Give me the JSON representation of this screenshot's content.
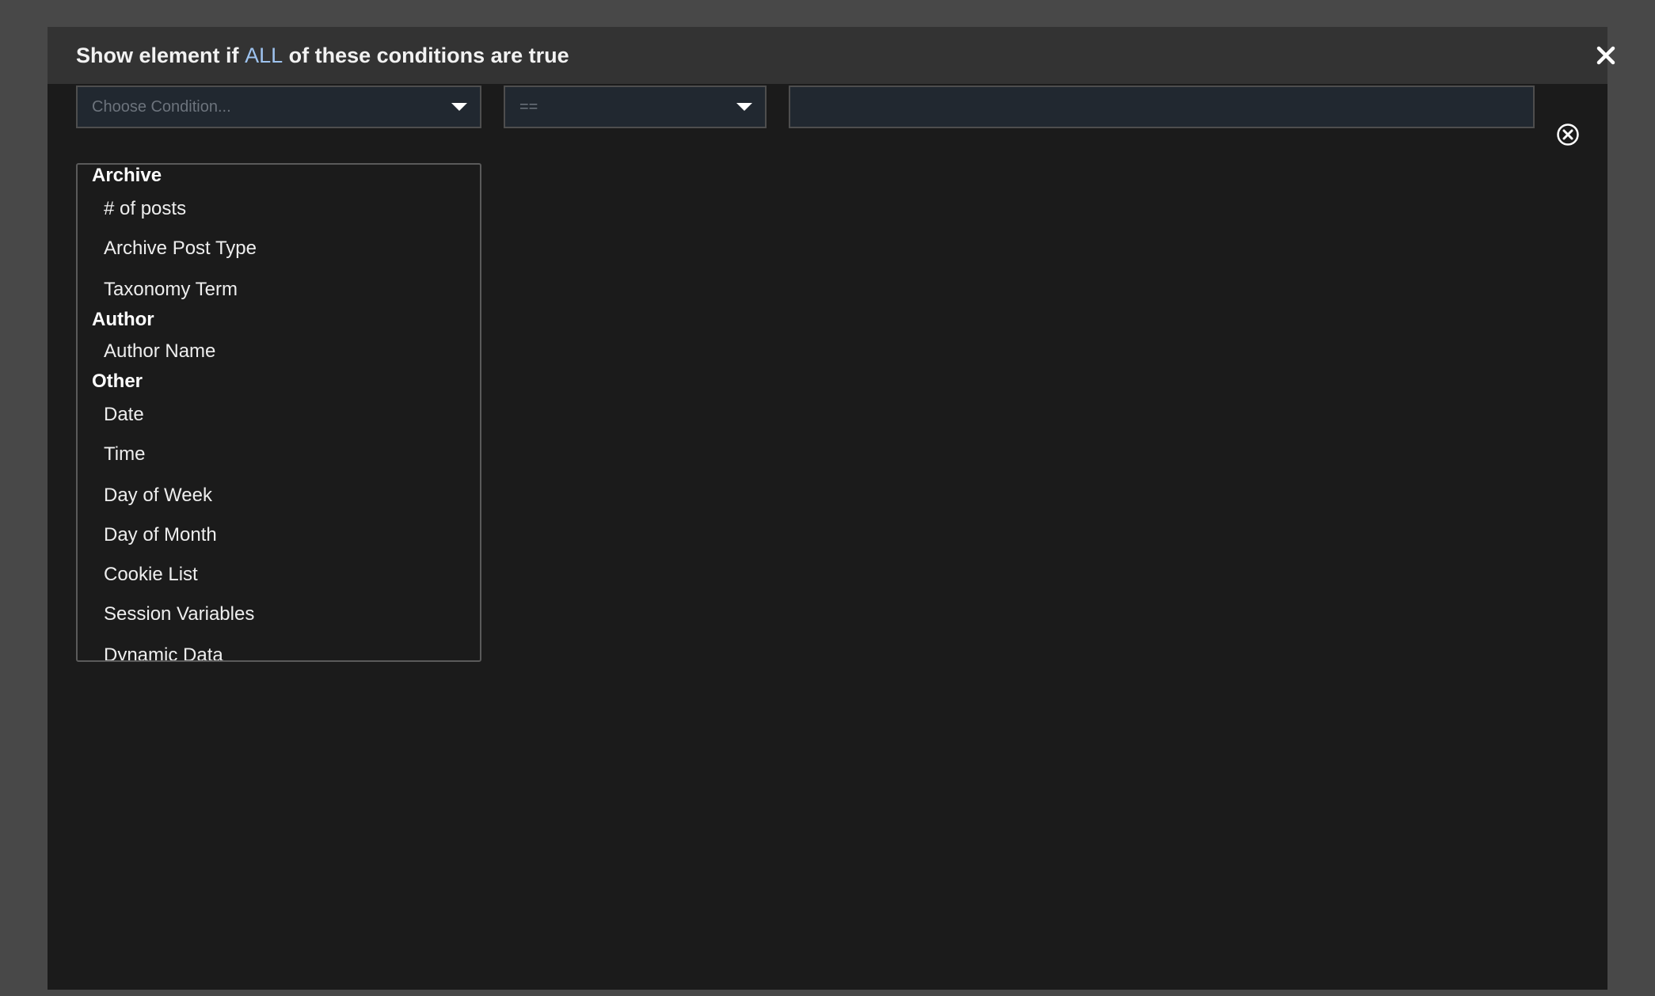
{
  "modal": {
    "title_prefix": "Show element if",
    "title_keyword": "ALL",
    "title_suffix": "of these conditions are true",
    "accent_color": "#9ec3ef"
  },
  "condition_row": {
    "condition_placeholder": "Choose Condition...",
    "operator_value": "==",
    "value_text": ""
  },
  "dropdown": {
    "groups": [
      {
        "label": "Archive",
        "options": [
          "# of posts",
          "Archive Post Type",
          "Taxonomy Term"
        ]
      },
      {
        "label": "Author",
        "options": [
          "Author Name"
        ]
      },
      {
        "label": "Other",
        "options": [
          "Date",
          "Time",
          "Day of Week",
          "Day of Month",
          "Cookie List",
          "Session Variables",
          "Dynamic Data"
        ]
      }
    ]
  },
  "icons": {
    "close": "close-icon",
    "remove": "remove-condition-icon",
    "caret": "chevron-down-icon"
  }
}
